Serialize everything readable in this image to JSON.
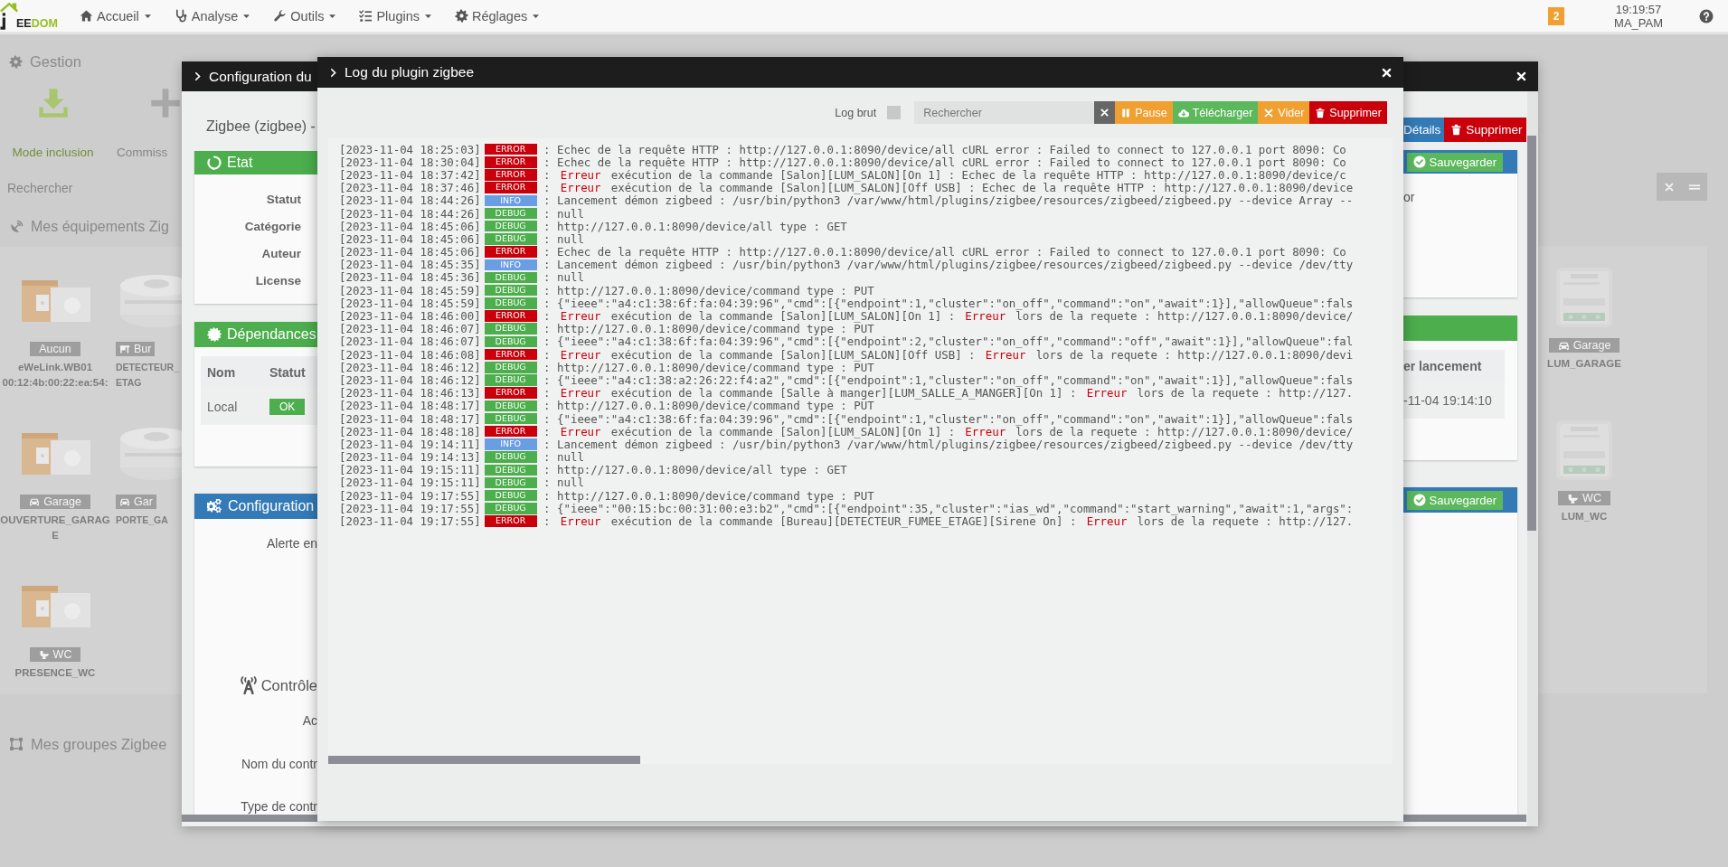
{
  "navbar": {
    "logo": {
      "dark": "EE",
      "green": "DOM"
    },
    "menu": [
      {
        "label": "Accueil",
        "kind": "home"
      },
      {
        "label": "Analyse",
        "kind": "analysis"
      },
      {
        "label": "Outils",
        "kind": "tools"
      },
      {
        "label": "Plugins",
        "kind": "plugins"
      },
      {
        "label": "Réglages",
        "kind": "settings"
      }
    ],
    "notification_count": "2",
    "time": "19:19:57",
    "user": "MA_PAM"
  },
  "background": {
    "section_title": "Gestion",
    "actions": [
      {
        "label": "Mode inclusion",
        "kind": "inclusion"
      },
      {
        "label": "Commiss",
        "kind": "add"
      }
    ],
    "search": {
      "placeholder": "Rechercher"
    },
    "devices_title": "Mes équipements Zig",
    "devices_left": [
      {
        "tag": {
          "label": "Aucun",
          "kind": "none"
        },
        "name_lines": [
          "eWeLink.WB01",
          "00:12:4b:00:22:ea:54:"
        ]
      },
      {
        "tag": {
          "label": "Bur",
          "kind": "office"
        },
        "name_lines": [
          "DETECTEUR_",
          "ETAG"
        ]
      },
      {
        "tag": {
          "label": "Garage",
          "kind": "car"
        },
        "name_lines": [
          "OUVERTURE_GARAG",
          "E"
        ]
      },
      {
        "tag": {
          "label": "Gar",
          "kind": "car"
        },
        "name_lines": [
          "PORTE_GA"
        ]
      },
      {
        "tag": {
          "label": "WC",
          "kind": "toilet"
        },
        "name_lines": [
          "PRESENCE_WC"
        ]
      }
    ],
    "devices_right": [
      {
        "tag": {
          "label": "Garage",
          "kind": "car"
        },
        "name_lines": [
          "LUM_GARAGE"
        ]
      },
      {
        "tag": {
          "label": "WC",
          "kind": "toilet"
        },
        "name_lines": [
          "LUM_WC"
        ]
      }
    ],
    "groups_title": "Mes groupes Zigbee"
  },
  "config_modal": {
    "title": "Configuration du",
    "subtitle": "Zigbee (zigbee) -",
    "actions": [
      {
        "label": "Détails",
        "kind": "details"
      },
      {
        "label": "Supprimer",
        "kind": "delete"
      }
    ],
    "status_panel": {
      "title": "Etat",
      "labels": [
        "Statut",
        "Catégorie",
        "Auteur",
        "License"
      ]
    },
    "side_panel": {
      "save_label": "Sauvegarder",
      "fragment": "or"
    },
    "dependencies": {
      "title": "Dépendances",
      "columns": [
        "Nom",
        "Statut"
      ],
      "rows": [
        {
          "name": "Local",
          "status": "OK",
          "kind": "ok"
        }
      ],
      "extra_column": "er lancement",
      "extra_value": "-11-04 19:14:10"
    },
    "configuration": {
      "title": "Configuration",
      "labels": [
        "Alerte en"
      ],
      "section": "Contrôle",
      "section_labels": [
        "Ac",
        "Nom du contr",
        "Type de contr"
      ],
      "save_label": "Sauvegarder"
    }
  },
  "log_modal": {
    "title": "Log du plugin zigbee",
    "raw_label": "Log brut",
    "raw_checked": false,
    "search": {
      "placeholder": "Rechercher"
    },
    "buttons": [
      {
        "label": "Pause",
        "kind": "pause"
      },
      {
        "label": "Télécharger",
        "kind": "download"
      },
      {
        "label": "Vider",
        "kind": "clear"
      },
      {
        "label": "Supprimer",
        "kind": "delete"
      }
    ],
    "lines": [
      {
        "time": "[2023-11-04 18:25:03]",
        "badge": "ERROR",
        "kind": "error",
        "parts": [
          {
            "text": " : Echec de la requête HTTP : http://127.0.0.1:8090/device/all cURL error : Failed to connect to 127.0.0.1 port 8090: Co",
            "kind": "plain"
          }
        ]
      },
      {
        "time": "[2023-11-04 18:30:04]",
        "badge": "ERROR",
        "kind": "error",
        "parts": [
          {
            "text": " : Echec de la requête HTTP : http://127.0.0.1:8090/device/all cURL error : Failed to connect to 127.0.0.1 port 8090: Co",
            "kind": "plain"
          }
        ]
      },
      {
        "time": "[2023-11-04 18:37:42]",
        "badge": "ERROR",
        "kind": "error",
        "parts": [
          {
            "text": " : ",
            "kind": "plain"
          },
          {
            "text": "Erreur",
            "kind": "error"
          },
          {
            "text": " exécution de la commande [Salon][LUM_SALON][On 1] : Echec de la requête HTTP : http://127.0.0.1:8090/device/c",
            "kind": "plain"
          }
        ]
      },
      {
        "time": "[2023-11-04 18:37:46]",
        "badge": "ERROR",
        "kind": "error",
        "parts": [
          {
            "text": " : ",
            "kind": "plain"
          },
          {
            "text": "Erreur",
            "kind": "error"
          },
          {
            "text": " exécution de la commande [Salon][LUM_SALON][Off USB] : Echec de la requête HTTP : http://127.0.0.1:8090/device",
            "kind": "plain"
          }
        ]
      },
      {
        "time": "[2023-11-04 18:44:26]",
        "badge": "INFO",
        "kind": "info",
        "parts": [
          {
            "text": " : Lancement démon zigbeed : /usr/bin/python3 /var/www/html/plugins/zigbee/resources/zigbeed/zigbeed.py --device Array --",
            "kind": "plain"
          }
        ]
      },
      {
        "time": "[2023-11-04 18:44:26]",
        "badge": "DEBUG",
        "kind": "debug",
        "parts": [
          {
            "text": " : null",
            "kind": "plain"
          }
        ]
      },
      {
        "time": "[2023-11-04 18:45:06]",
        "badge": "DEBUG",
        "kind": "debug",
        "parts": [
          {
            "text": " : http://127.0.0.1:8090/device/all type : GET",
            "kind": "plain"
          }
        ]
      },
      {
        "time": "[2023-11-04 18:45:06]",
        "badge": "DEBUG",
        "kind": "debug",
        "parts": [
          {
            "text": " : null",
            "kind": "plain"
          }
        ]
      },
      {
        "time": "[2023-11-04 18:45:06]",
        "badge": "ERROR",
        "kind": "error",
        "parts": [
          {
            "text": " : Echec de la requête HTTP : http://127.0.0.1:8090/device/all cURL error : Failed to connect to 127.0.0.1 port 8090: Co",
            "kind": "plain"
          }
        ]
      },
      {
        "time": "[2023-11-04 18:45:35]",
        "badge": "INFO",
        "kind": "info",
        "parts": [
          {
            "text": " : Lancement démon zigbeed : /usr/bin/python3 /var/www/html/plugins/zigbee/resources/zigbeed/zigbeed.py --device /dev/tty",
            "kind": "plain"
          }
        ]
      },
      {
        "time": "[2023-11-04 18:45:36]",
        "badge": "DEBUG",
        "kind": "debug",
        "parts": [
          {
            "text": " : null",
            "kind": "plain"
          }
        ]
      },
      {
        "time": "[2023-11-04 18:45:59]",
        "badge": "DEBUG",
        "kind": "debug",
        "parts": [
          {
            "text": " : http://127.0.0.1:8090/device/command type : PUT",
            "kind": "plain"
          }
        ]
      },
      {
        "time": "[2023-11-04 18:45:59]",
        "badge": "DEBUG",
        "kind": "debug",
        "parts": [
          {
            "text": " : {\"ieee\":\"a4:c1:38:6f:fa:04:39:96\",\"cmd\":[{\"endpoint\":1,\"cluster\":\"on_off\",\"command\":\"on\",\"await\":1}],\"allowQueue\":fals",
            "kind": "plain"
          }
        ]
      },
      {
        "time": "[2023-11-04 18:46:00]",
        "badge": "ERROR",
        "kind": "error",
        "parts": [
          {
            "text": " : ",
            "kind": "plain"
          },
          {
            "text": "Erreur",
            "kind": "error"
          },
          {
            "text": " exécution de la commande [Salon][LUM_SALON][On 1] : ",
            "kind": "plain"
          },
          {
            "text": "Erreur",
            "kind": "error"
          },
          {
            "text": " lors de la requete : http://127.0.0.1:8090/device/",
            "kind": "plain"
          }
        ]
      },
      {
        "time": "[2023-11-04 18:46:07]",
        "badge": "DEBUG",
        "kind": "debug",
        "parts": [
          {
            "text": " : http://127.0.0.1:8090/device/command type : PUT",
            "kind": "plain"
          }
        ]
      },
      {
        "time": "[2023-11-04 18:46:07]",
        "badge": "DEBUG",
        "kind": "debug",
        "parts": [
          {
            "text": " : {\"ieee\":\"a4:c1:38:6f:fa:04:39:96\",\"cmd\":[{\"endpoint\":2,\"cluster\":\"on_off\",\"command\":\"off\",\"await\":1}],\"allowQueue\":fal",
            "kind": "plain"
          }
        ]
      },
      {
        "time": "[2023-11-04 18:46:08]",
        "badge": "ERROR",
        "kind": "error",
        "parts": [
          {
            "text": " : ",
            "kind": "plain"
          },
          {
            "text": "Erreur",
            "kind": "error"
          },
          {
            "text": " exécution de la commande [Salon][LUM_SALON][Off USB] : ",
            "kind": "plain"
          },
          {
            "text": "Erreur",
            "kind": "error"
          },
          {
            "text": " lors de la requete : http://127.0.0.1:8090/devi",
            "kind": "plain"
          }
        ]
      },
      {
        "time": "[2023-11-04 18:46:12]",
        "badge": "DEBUG",
        "kind": "debug",
        "parts": [
          {
            "text": " : http://127.0.0.1:8090/device/command type : PUT",
            "kind": "plain"
          }
        ]
      },
      {
        "time": "[2023-11-04 18:46:12]",
        "badge": "DEBUG",
        "kind": "debug",
        "parts": [
          {
            "text": " : {\"ieee\":\"a4:c1:38:a2:26:22:f4:a2\",\"cmd\":[{\"endpoint\":1,\"cluster\":\"on_off\",\"command\":\"on\",\"await\":1}],\"allowQueue\":fals",
            "kind": "plain"
          }
        ]
      },
      {
        "time": "[2023-11-04 18:46:13]",
        "badge": "ERROR",
        "kind": "error",
        "parts": [
          {
            "text": " : ",
            "kind": "plain"
          },
          {
            "text": "Erreur",
            "kind": "error"
          },
          {
            "text": " exécution de la commande [Salle à manger][LUM_SALLE_A_MANGER][On 1] : ",
            "kind": "plain"
          },
          {
            "text": "Erreur",
            "kind": "error"
          },
          {
            "text": " lors de la requete : http://127.",
            "kind": "plain"
          }
        ]
      },
      {
        "time": "[2023-11-04 18:48:17]",
        "badge": "DEBUG",
        "kind": "debug",
        "parts": [
          {
            "text": " : http://127.0.0.1:8090/device/command type : PUT",
            "kind": "plain"
          }
        ]
      },
      {
        "time": "[2023-11-04 18:48:17]",
        "badge": "DEBUG",
        "kind": "debug",
        "parts": [
          {
            "text": " : {\"ieee\":\"a4:c1:38:6f:fa:04:39:96\",\"cmd\":[{\"endpoint\":1,\"cluster\":\"on_off\",\"command\":\"on\",\"await\":1}],\"allowQueue\":fals",
            "kind": "plain"
          }
        ]
      },
      {
        "time": "[2023-11-04 18:48:18]",
        "badge": "ERROR",
        "kind": "error",
        "parts": [
          {
            "text": " : ",
            "kind": "plain"
          },
          {
            "text": "Erreur",
            "kind": "error"
          },
          {
            "text": " exécution de la commande [Salon][LUM_SALON][On 1] : ",
            "kind": "plain"
          },
          {
            "text": "Erreur",
            "kind": "error"
          },
          {
            "text": " lors de la requete : http://127.0.0.1:8090/device/",
            "kind": "plain"
          }
        ]
      },
      {
        "time": "[2023-11-04 19:14:11]",
        "badge": "INFO",
        "kind": "info",
        "parts": [
          {
            "text": " : Lancement démon zigbeed : /usr/bin/python3 /var/www/html/plugins/zigbee/resources/zigbeed/zigbeed.py --device /dev/tty",
            "kind": "plain"
          }
        ]
      },
      {
        "time": "[2023-11-04 19:14:13]",
        "badge": "DEBUG",
        "kind": "debug",
        "parts": [
          {
            "text": " : null",
            "kind": "plain"
          }
        ]
      },
      {
        "time": "[2023-11-04 19:15:11]",
        "badge": "DEBUG",
        "kind": "debug",
        "parts": [
          {
            "text": " : http://127.0.0.1:8090/device/all type : GET",
            "kind": "plain"
          }
        ]
      },
      {
        "time": "[2023-11-04 19:15:11]",
        "badge": "DEBUG",
        "kind": "debug",
        "parts": [
          {
            "text": " : null",
            "kind": "plain"
          }
        ]
      },
      {
        "time": "[2023-11-04 19:17:55]",
        "badge": "DEBUG",
        "kind": "debug",
        "parts": [
          {
            "text": " : http://127.0.0.1:8090/device/command type : PUT",
            "kind": "plain"
          }
        ]
      },
      {
        "time": "[2023-11-04 19:17:55]",
        "badge": "DEBUG",
        "kind": "debug",
        "parts": [
          {
            "text": " : {\"ieee\":\"00:15:bc:00:31:00:e3:b2\",\"cmd\":[{\"endpoint\":35,\"cluster\":\"ias_wd\",\"command\":\"start_warning\",\"await\":1,\"args\":",
            "kind": "plain"
          }
        ]
      },
      {
        "time": "[2023-11-04 19:17:55]",
        "badge": "ERROR",
        "kind": "error",
        "parts": [
          {
            "text": " : ",
            "kind": "plain"
          },
          {
            "text": "Erreur",
            "kind": "error"
          },
          {
            "text": " exécution de la commande [Bureau][DETECTEUR_FUMEE_ETAGE][Sirene On] : ",
            "kind": "plain"
          },
          {
            "text": "Erreur",
            "kind": "error"
          },
          {
            "text": " lors de la requete : http://127.",
            "kind": "plain"
          }
        ]
      }
    ]
  }
}
